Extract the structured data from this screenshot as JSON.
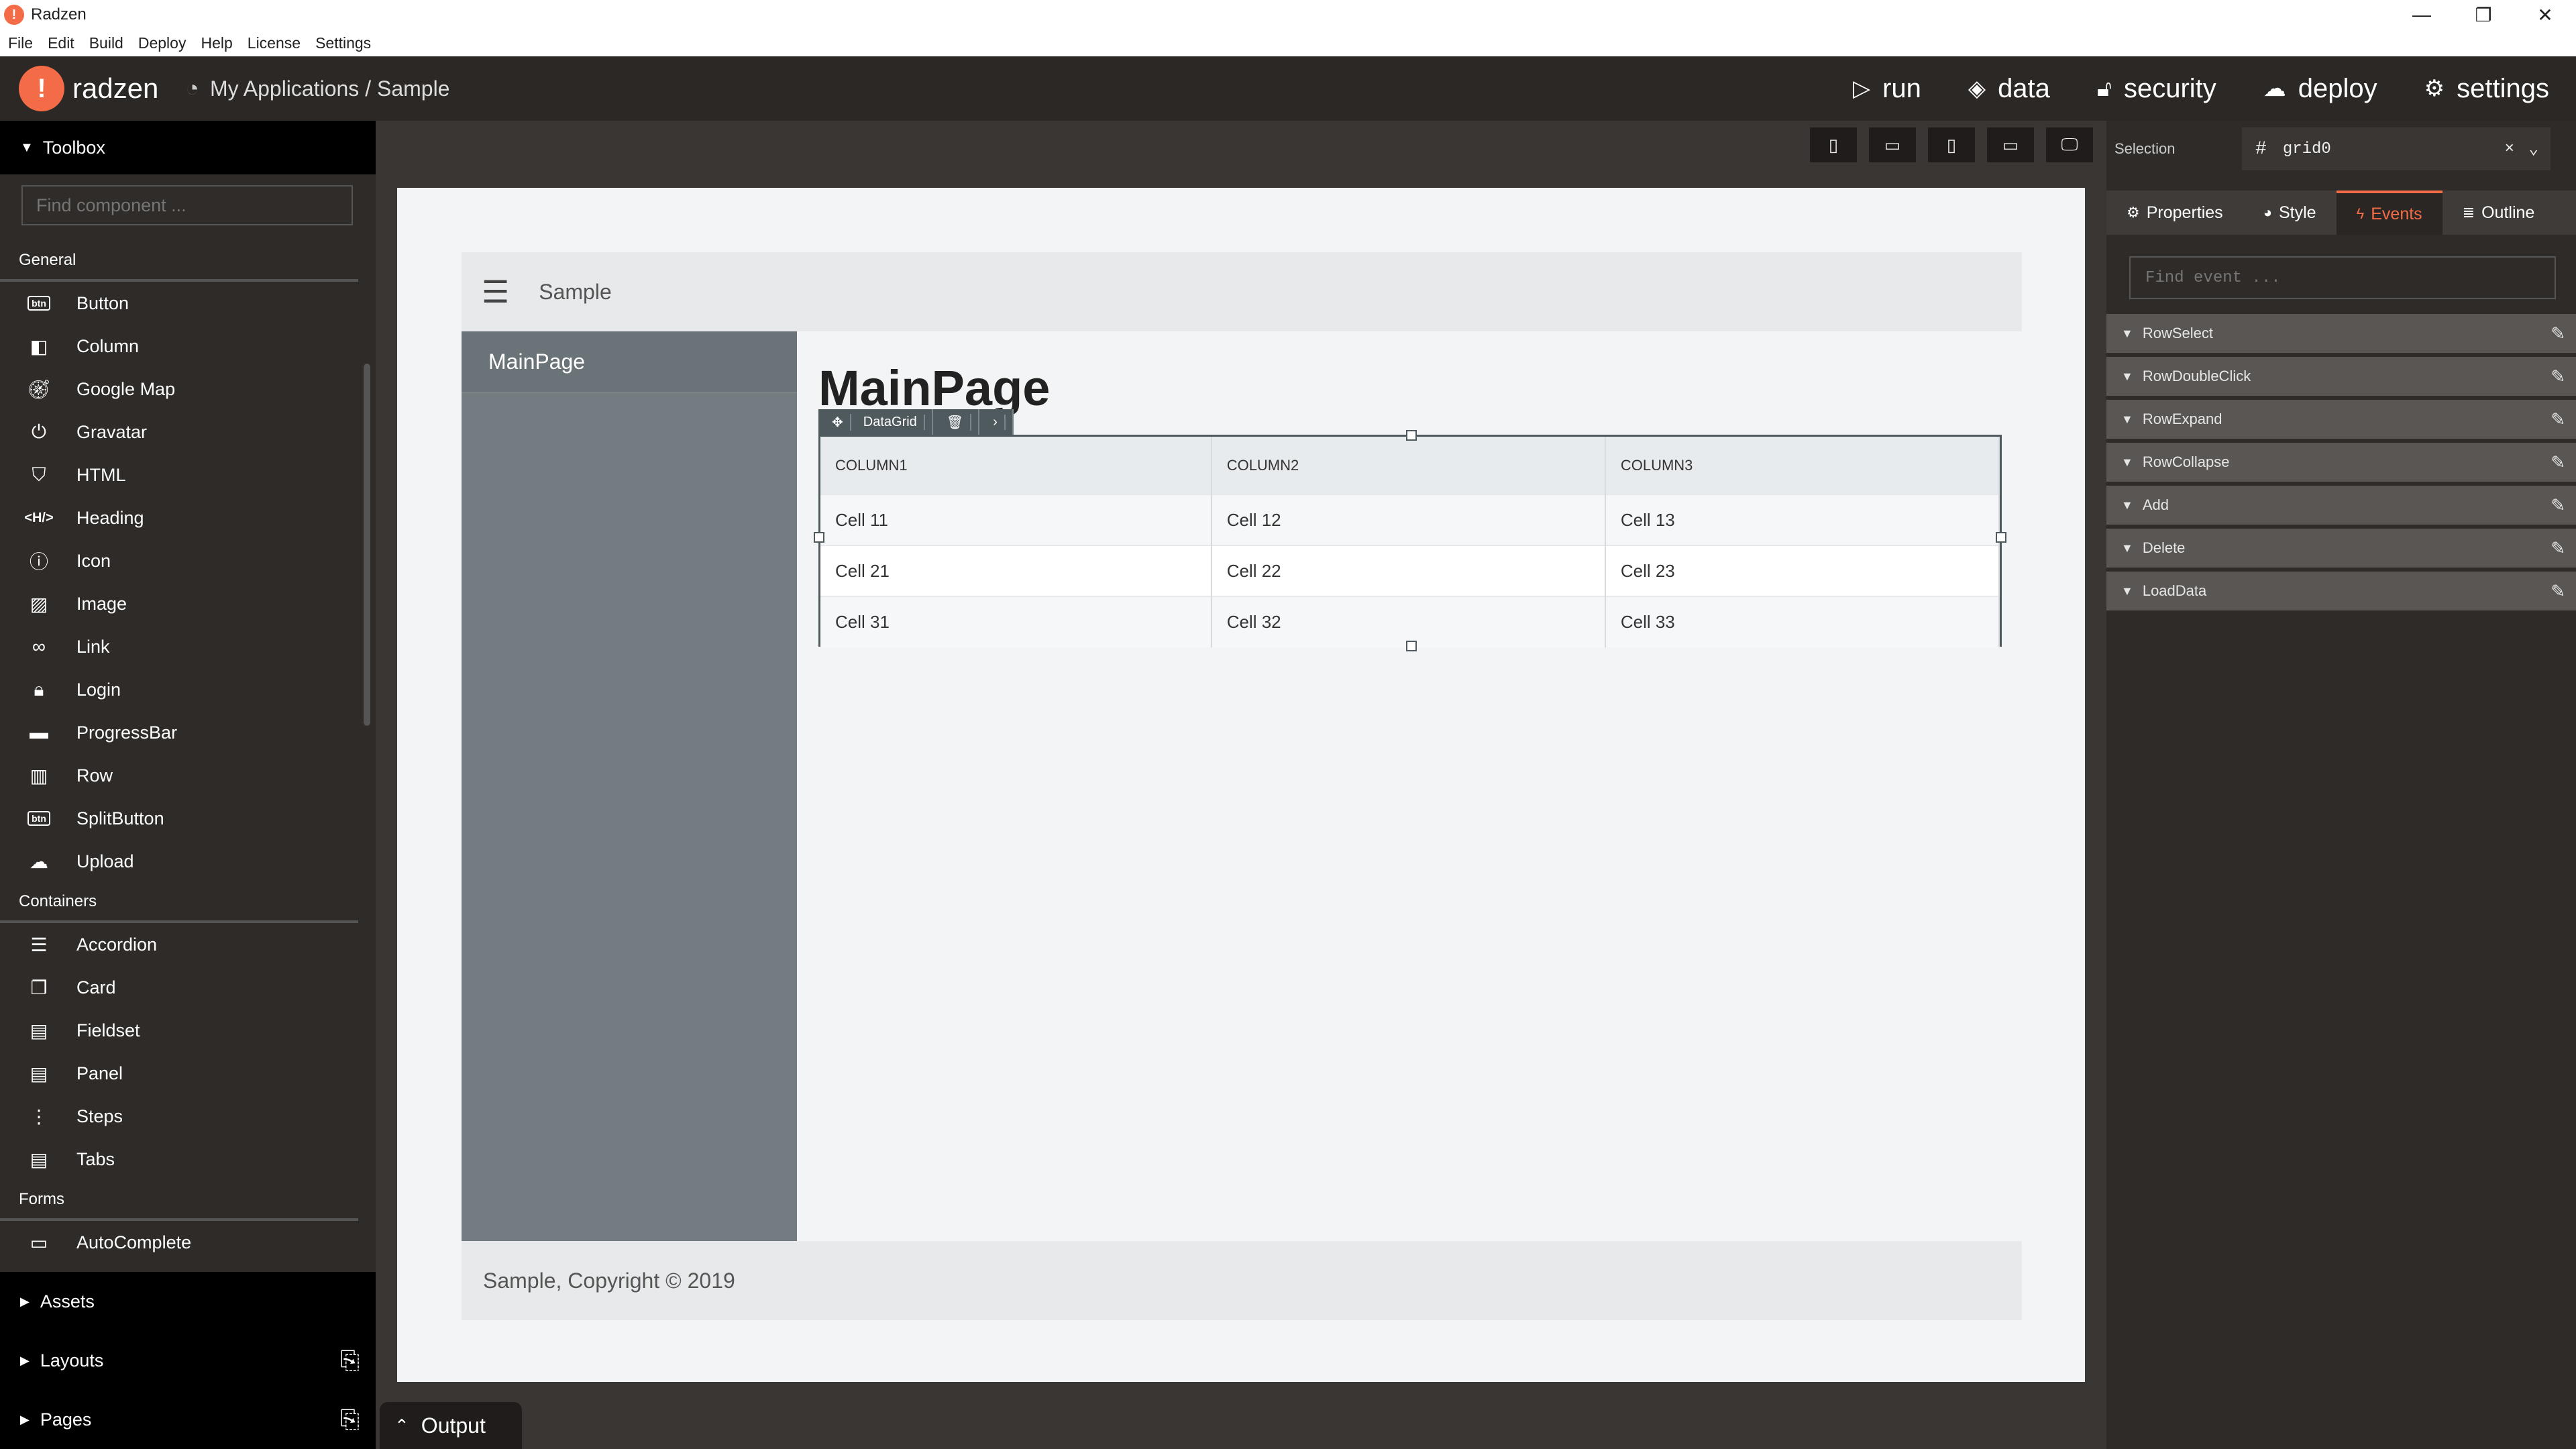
{
  "window": {
    "title": "Radzen",
    "logo_letter": "!",
    "min": "—",
    "restore": "❐",
    "close": "✕"
  },
  "menu": [
    "File",
    "Edit",
    "Build",
    "Deploy",
    "Help",
    "License",
    "Settings"
  ],
  "header": {
    "logo_text": "radzen",
    "breadcrumb": "My Applications / Sample",
    "nav": [
      {
        "label": "run",
        "icon": "play-icon"
      },
      {
        "label": "data",
        "icon": "layers-icon"
      },
      {
        "label": "security",
        "icon": "lock-icon"
      },
      {
        "label": "deploy",
        "icon": "cloud-upload-icon"
      },
      {
        "label": "settings",
        "icon": "gear-icon"
      }
    ]
  },
  "toolbox": {
    "title": "Toolbox",
    "search_placeholder": "Find component ...",
    "categories": [
      {
        "name": "General",
        "items": [
          "Button",
          "Column",
          "Google Map",
          "Gravatar",
          "HTML",
          "Heading",
          "Icon",
          "Image",
          "Link",
          "Login",
          "ProgressBar",
          "Row",
          "SplitButton",
          "Upload"
        ]
      },
      {
        "name": "Containers",
        "items": [
          "Accordion",
          "Card",
          "Fieldset",
          "Panel",
          "Steps",
          "Tabs"
        ]
      },
      {
        "name": "Forms",
        "items": [
          "AutoComplete"
        ]
      }
    ],
    "footer": [
      "Assets",
      "Layouts",
      "Pages"
    ]
  },
  "canvas": {
    "app_title": "Sample",
    "sidebar_item": "MainPage",
    "page_title": "MainPage",
    "footer": "Sample, Copyright © 2019",
    "grid_label": "DataGrid",
    "columns": [
      "COLUMN1",
      "COLUMN2",
      "COLUMN3"
    ],
    "rows": [
      [
        "Cell 11",
        "Cell 12",
        "Cell 13"
      ],
      [
        "Cell 21",
        "Cell 22",
        "Cell 23"
      ],
      [
        "Cell 31",
        "Cell 32",
        "Cell 33"
      ]
    ]
  },
  "output": {
    "label": "Output"
  },
  "inspector": {
    "selection_label": "Selection",
    "selection_value": "grid0",
    "tabs": [
      "Properties",
      "Style",
      "Events",
      "Outline"
    ],
    "active_tab": "Events",
    "find_placeholder": "Find event ...",
    "events": [
      "RowSelect",
      "RowDoubleClick",
      "RowExpand",
      "RowCollapse",
      "Add",
      "Delete",
      "LoadData"
    ]
  }
}
